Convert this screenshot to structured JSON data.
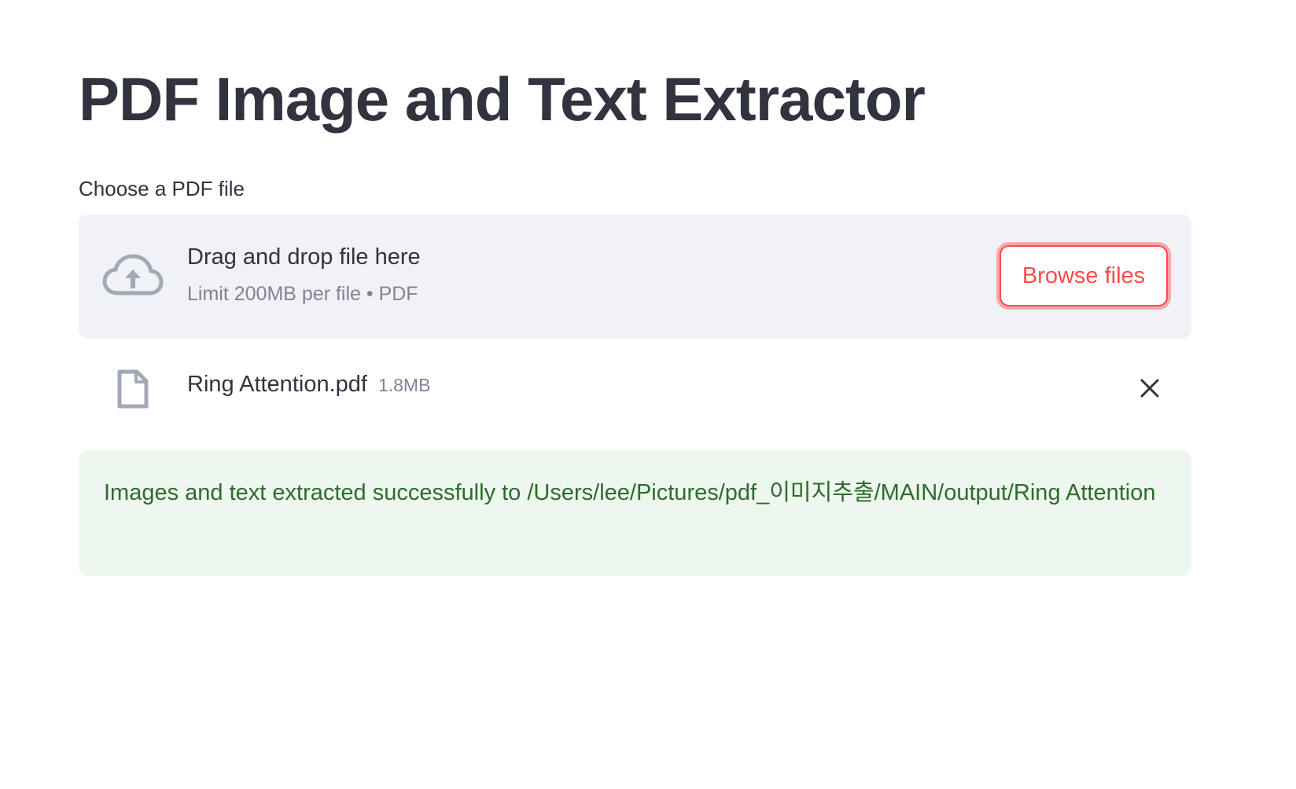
{
  "page": {
    "title": "PDF Image and Text Extractor"
  },
  "uploader": {
    "label": "Choose a PDF file",
    "dropzone": {
      "title": "Drag and drop file here",
      "limit": "Limit 200MB per file • PDF",
      "icon": "cloud-upload-icon"
    },
    "browse_label": "Browse files",
    "file": {
      "name": "Ring Attention.pdf",
      "size": "1.8MB",
      "icon": "file-icon",
      "remove_icon": "close-icon"
    }
  },
  "alert": {
    "type": "success",
    "message": "Images and text extracted successfully to /Users/lee/Pictures/pdf_이미지추출/MAIN/output/Ring Attention"
  },
  "colors": {
    "accent": "#ff4b4b",
    "text": "#31333f",
    "muted": "#808495",
    "dropzone_bg": "#f0f2f6",
    "icon": "#a3a8b8",
    "success_bg": "#edf7ee",
    "success_text": "#2e6b2e"
  }
}
